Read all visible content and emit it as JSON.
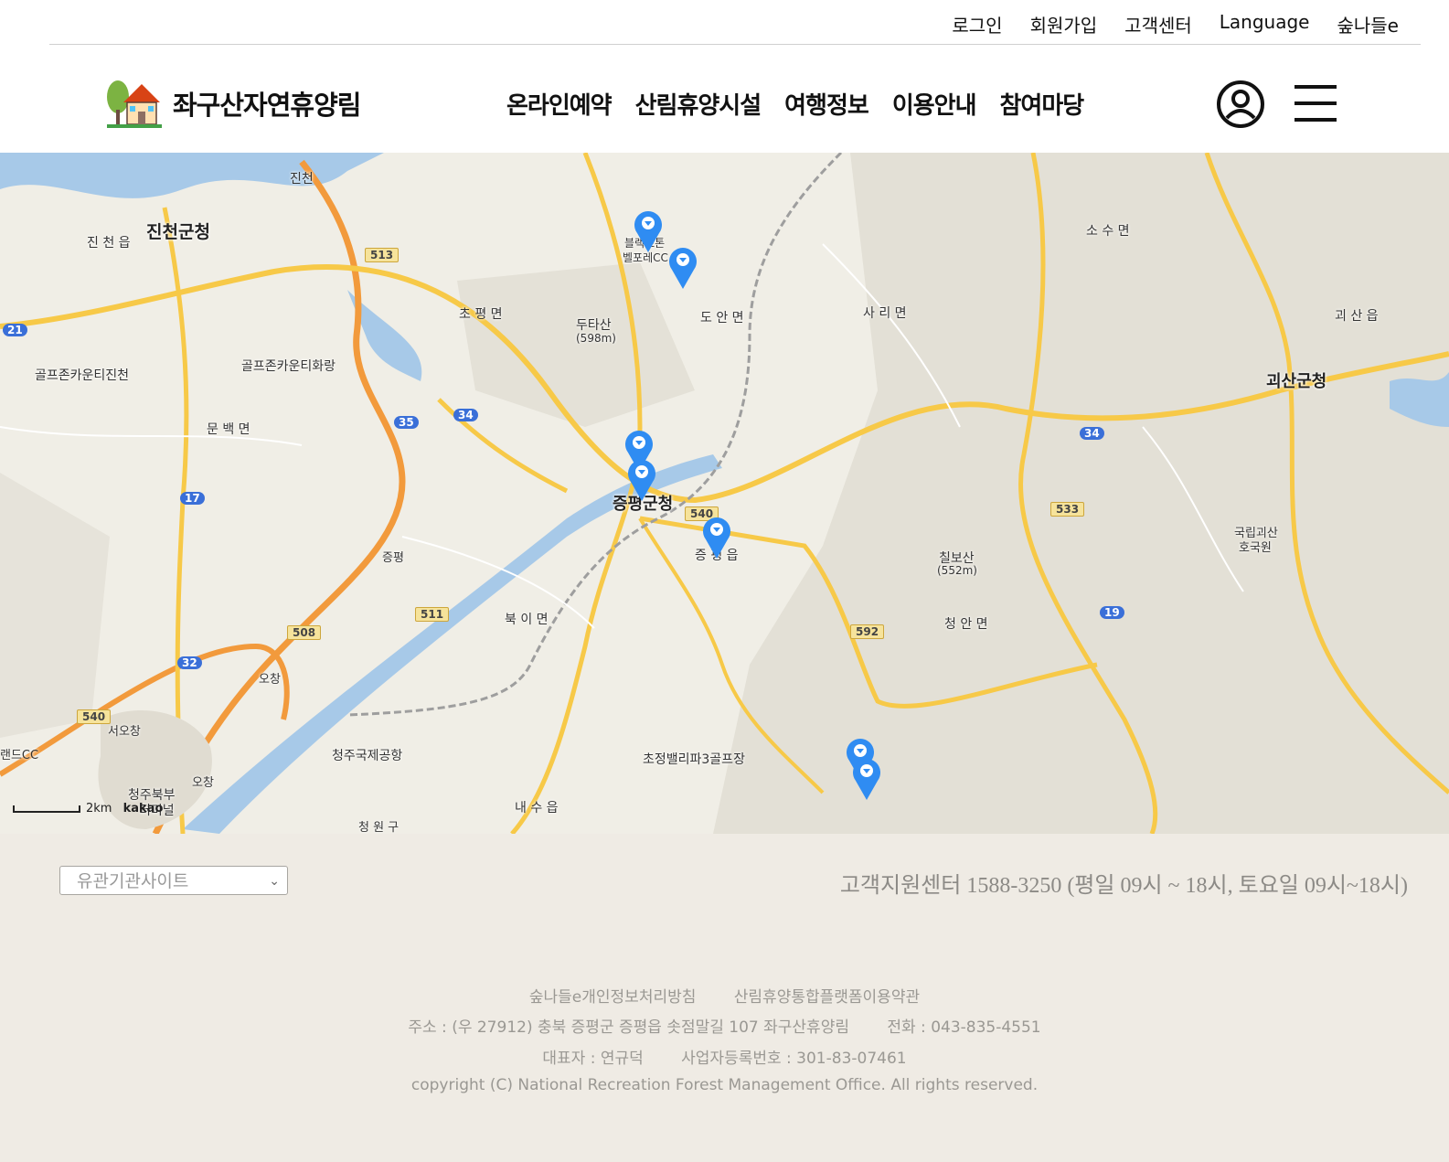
{
  "util_nav": [
    "로그인",
    "회원가입",
    "고객센터",
    "Language",
    "숲나들e"
  ],
  "site": {
    "title": "좌구산자연휴양림"
  },
  "gnb": [
    "온라인예약",
    "산림휴양시설",
    "여행정보",
    "이용안내",
    "참여마당"
  ],
  "map": {
    "labels": {
      "jincheon": "진천",
      "jincheon_office": "진천군청",
      "jincheon_eup": "진 천 읍",
      "chopyeong": "초 평 면",
      "dutasan": "두타산",
      "dutasan_h": "(598m)",
      "blackstone": "블랙스톤",
      "bellfore": "벨포레CC",
      "doan": "도 안 면",
      "sari": "사 리 면",
      "sosu": "소 수 면",
      "goesan_eup": "괴 산 읍",
      "goesan_office": "괴산군청",
      "golf_jincheon": "골프존카운티진천",
      "golf_hwarang": "골프존카운티화랑",
      "munbaek": "문 백 면",
      "jeungpyeong_office": "증평군청",
      "jeungpyeong_eup": "증 평 읍",
      "jeungpyeong_ic": "증평",
      "chilbosan": "칠보산",
      "chilbosan_h": "(552m)",
      "cheongan": "청 안 면",
      "goesan_forest1": "국립괴산",
      "goesan_forest2": "호국원",
      "bugi": "북 이 면",
      "ochang": "오창",
      "ochang2": "오창",
      "seoochang": "서오창",
      "airport": "청주국제공항",
      "chojeong": "초정밸리파3골프장",
      "cheongju_bukbu1": "청주북부",
      "cheongju_bukbu2": "터미널",
      "naesu": "내 수 읍",
      "cc_left": "랜드CC",
      "cheongwon": "청 원 구"
    },
    "roads": [
      "513",
      "35",
      "34",
      "21",
      "17",
      "540",
      "533",
      "34",
      "19",
      "592",
      "511",
      "508",
      "32",
      "540"
    ],
    "scale": "2km",
    "attribution": "kakao"
  },
  "footer": {
    "select_placeholder": "유관기관사이트",
    "cs_text": "고객지원센터 1588-3250 (평일 09시 ~ 18시, 토요일 09시~18시)",
    "links": [
      "숲나들e개인정보처리방침",
      "산림휴양통합플랫폼이용약관"
    ],
    "address": "주소 : (우 27912) 충북 증평군 증평읍 솟점말길 107 좌구산휴양림",
    "phone": "전화 : 043-835-4551",
    "ceo": "대표자 : 연규덕",
    "bizno": "사업자등록번호 : 301-83-07461",
    "copyright": "copyright (C) National Recreation Forest Management Office. All rights reserved."
  },
  "colors": {
    "marker": "#2f8cf2",
    "footer_bg": "#efebe4",
    "map_bg": "#f0eee6",
    "highway": "#f29a3c",
    "road": "#f7c948",
    "water": "#a7c9e8"
  }
}
